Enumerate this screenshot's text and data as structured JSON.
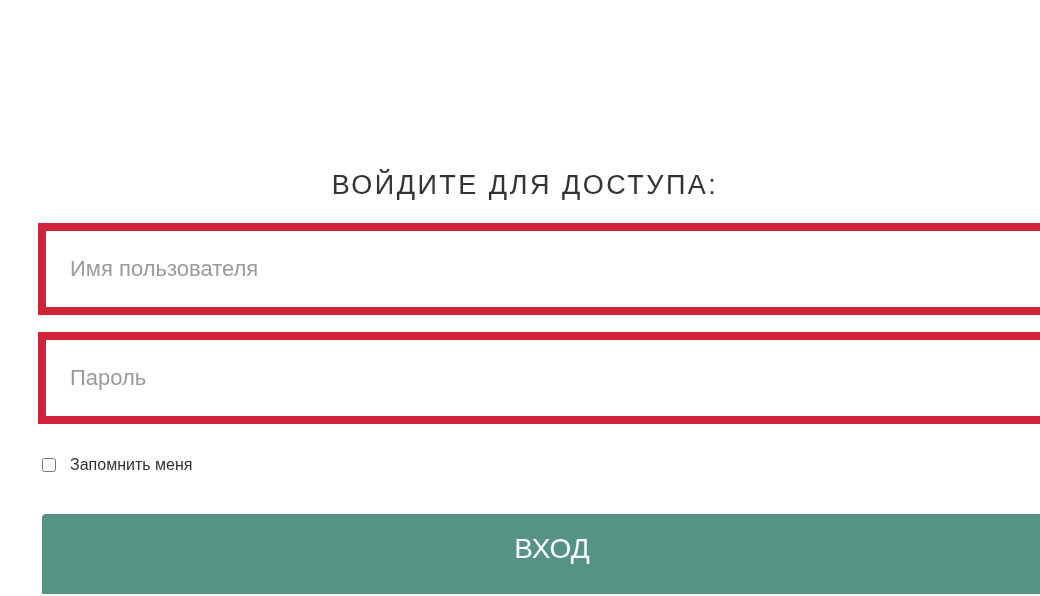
{
  "heading": "ВОЙДИТЕ ДЛЯ ДОСТУПА:",
  "fields": [
    {
      "placeholder": "Имя пользователя",
      "error": true
    },
    {
      "placeholder": "Пароль",
      "error": true
    }
  ],
  "remember": {
    "label": "Запомнить меня",
    "checked": false
  },
  "submit": {
    "label": "ВХОД"
  }
}
